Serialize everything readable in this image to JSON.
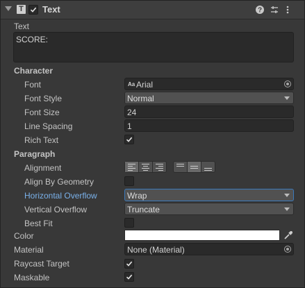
{
  "component": {
    "title": "Text",
    "type_icon": "text-component-icon",
    "enabled": true,
    "header_icons": [
      "help-icon",
      "presets-icon",
      "kebab-menu-icon"
    ]
  },
  "text_section": {
    "label": "Text",
    "value": "SCORE:"
  },
  "character": {
    "heading": "Character",
    "font_label": "Font",
    "font_value": "Arial",
    "font_icon_text": "Aa",
    "font_style_label": "Font Style",
    "font_style_value": "Normal",
    "font_size_label": "Font Size",
    "font_size_value": "24",
    "line_spacing_label": "Line Spacing",
    "line_spacing_value": "1",
    "rich_text_label": "Rich Text",
    "rich_text_checked": true
  },
  "paragraph": {
    "heading": "Paragraph",
    "alignment_label": "Alignment",
    "horizontal_alignment": [
      "left",
      "center",
      "right"
    ],
    "horizontal_selected": "left",
    "vertical_alignment": [
      "top",
      "middle",
      "bottom"
    ],
    "vertical_selected": "middle",
    "align_by_geometry_label": "Align By Geometry",
    "align_by_geometry_checked": false,
    "horizontal_overflow_label": "Horizontal Overflow",
    "horizontal_overflow_value": "Wrap",
    "vertical_overflow_label": "Vertical Overflow",
    "vertical_overflow_value": "Truncate",
    "best_fit_label": "Best Fit",
    "best_fit_checked": false
  },
  "color": {
    "label": "Color",
    "value": "#ffffff"
  },
  "material": {
    "label": "Material",
    "value": "None (Material)"
  },
  "raycast": {
    "label": "Raycast Target",
    "checked": true
  },
  "maskable": {
    "label": "Maskable",
    "checked": true
  },
  "colors": {
    "accent_blue": "#7ab1ea",
    "focus_border": "#3a79bb",
    "panel_bg": "#383838"
  }
}
